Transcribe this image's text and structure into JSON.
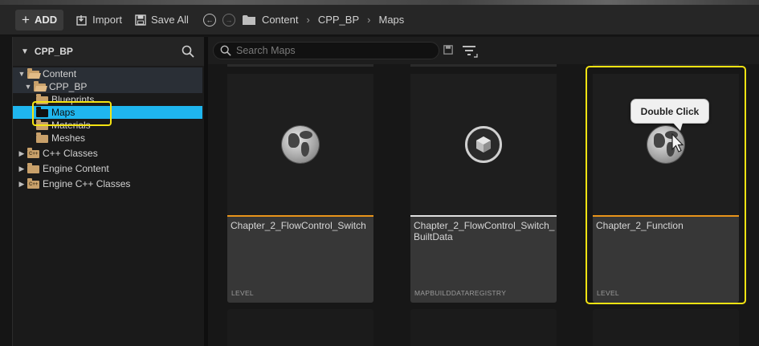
{
  "toolbar": {
    "add_label": "ADD",
    "import_label": "Import",
    "save_all_label": "Save All",
    "breadcrumbs": [
      "Content",
      "CPP_BP",
      "Maps"
    ]
  },
  "sources": {
    "header_title": "CPP_BP",
    "tree": [
      {
        "label": "Content",
        "state": "expanded"
      },
      {
        "label": "CPP_BP",
        "state": "expanded"
      },
      {
        "label": "Blueprints",
        "state": "leaf"
      },
      {
        "label": "Maps",
        "state": "selected"
      },
      {
        "label": "Materials",
        "state": "leaf"
      },
      {
        "label": "Meshes",
        "state": "leaf"
      },
      {
        "label": "C++ Classes",
        "state": "collapsed"
      },
      {
        "label": "Engine Content",
        "state": "collapsed"
      },
      {
        "label": "Engine C++ Classes",
        "state": "collapsed"
      }
    ]
  },
  "filter": {
    "search_placeholder": "Search Maps"
  },
  "assets": [
    {
      "name": "Chapter_2_FlowControl_Switch",
      "type": "LEVEL",
      "icon": "globe-icon",
      "accent": "#e8941a"
    },
    {
      "name": "Chapter_2_FlowControl_Switch_BuiltData",
      "type": "MAPBUILDDATAREGISTRY",
      "icon": "cube-icon",
      "accent": "#e0e0e0"
    },
    {
      "name": "Chapter_2_Function",
      "type": "LEVEL",
      "icon": "globe-icon",
      "accent": "#e8941a"
    }
  ],
  "tooltip": {
    "text": "Double Click"
  },
  "colors": {
    "selection": "#1fb6ef",
    "highlight": "#f4e312",
    "level_accent": "#e8941a"
  }
}
